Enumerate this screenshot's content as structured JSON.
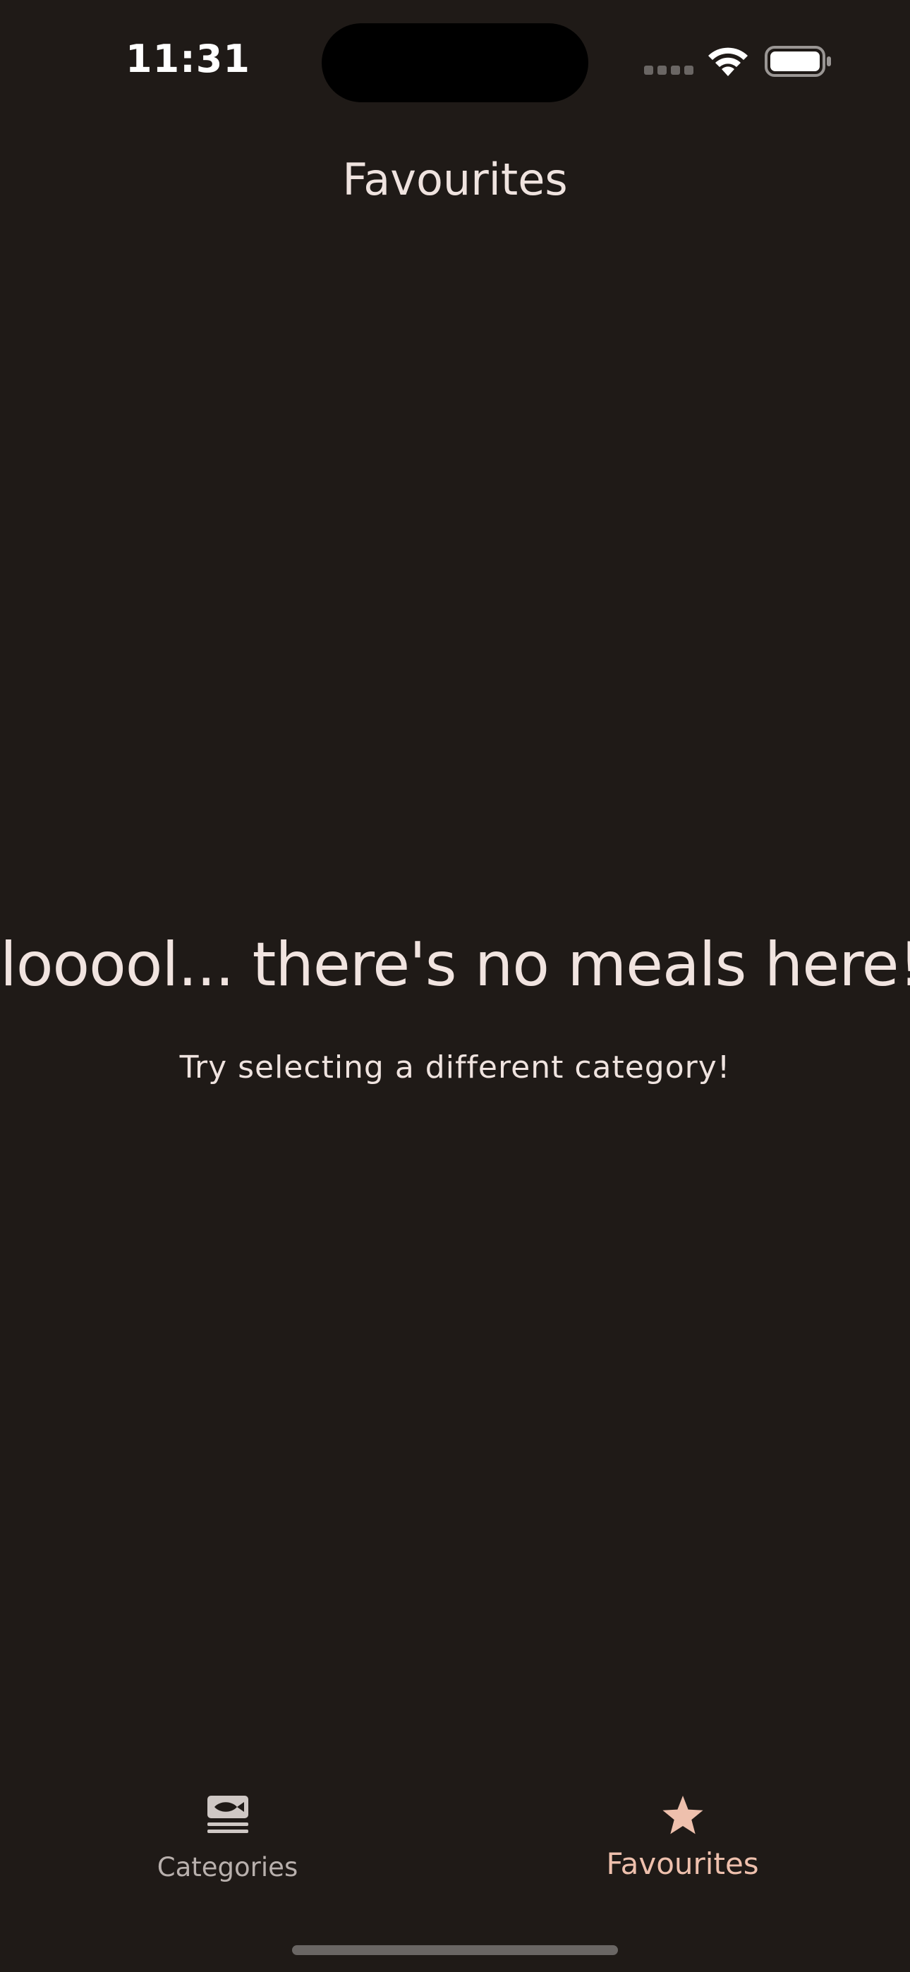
{
  "status_bar": {
    "time": "11:31"
  },
  "nav": {
    "title": "Favourites"
  },
  "empty_state": {
    "heading": "looool... there's no meals here!",
    "subtitle": "Try selecting a different category!"
  },
  "tab_bar": {
    "tabs": [
      {
        "label": "Categories",
        "icon": "set-meal-icon",
        "selected": false
      },
      {
        "label": "Favourites",
        "icon": "star-icon",
        "selected": true
      }
    ]
  },
  "colors": {
    "background": "#1f1a17",
    "text": "#efe3df",
    "accent": "#eec0ad",
    "inactive": "#b8b0ad"
  }
}
